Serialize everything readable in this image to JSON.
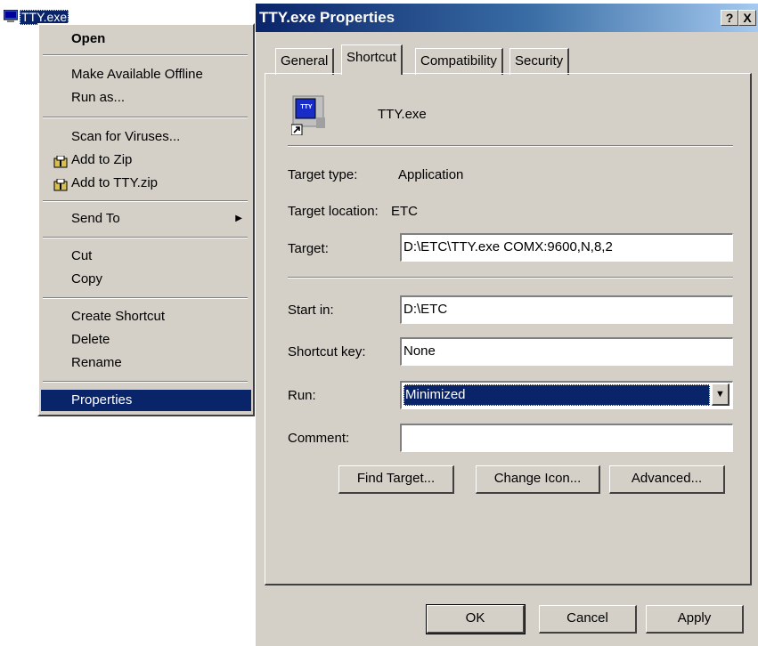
{
  "desktop": {
    "file_label": "TTY.exe"
  },
  "context_menu": {
    "items": [
      {
        "label": "Open"
      },
      {
        "label": "Make Available Offline"
      },
      {
        "label": "Run as..."
      },
      {
        "label": "Scan for Viruses..."
      },
      {
        "label": "Add to Zip"
      },
      {
        "label": "Add to TTY.zip"
      },
      {
        "label": "Send To"
      },
      {
        "label": "Cut"
      },
      {
        "label": "Copy"
      },
      {
        "label": "Create Shortcut"
      },
      {
        "label": "Delete"
      },
      {
        "label": "Rename"
      },
      {
        "label": "Properties"
      }
    ]
  },
  "dialog": {
    "title": "TTY.exe Properties",
    "help_button": "?",
    "close_button": "X",
    "tabs": [
      {
        "label": "General"
      },
      {
        "label": "Shortcut"
      },
      {
        "label": "Compatibility"
      },
      {
        "label": "Security"
      }
    ],
    "file_name": "TTY.exe",
    "icon_text": "TTY",
    "target_type_label": "Target type:",
    "target_type_value": "Application",
    "target_location_label": "Target location:",
    "target_location_value": "ETC",
    "target_label": "Target:",
    "target_value": "D:\\ETC\\TTY.exe  COMX:9600,N,8,2",
    "start_in_label": "Start in:",
    "start_in_value": "D:\\ETC",
    "shortcut_key_label": "Shortcut key:",
    "shortcut_key_value": "None",
    "run_label": "Run:",
    "run_value": "Minimized",
    "comment_label": "Comment:",
    "comment_value": "",
    "find_target_button": "Find Target...",
    "change_icon_button": "Change Icon...",
    "advanced_button": "Advanced...",
    "ok_button": "OK",
    "cancel_button": "Cancel",
    "apply_button": "Apply"
  },
  "colors": {
    "face": "#d4d0c8",
    "selection": "#0a246a",
    "title_start": "#0a246a",
    "title_end": "#a6caf0"
  }
}
